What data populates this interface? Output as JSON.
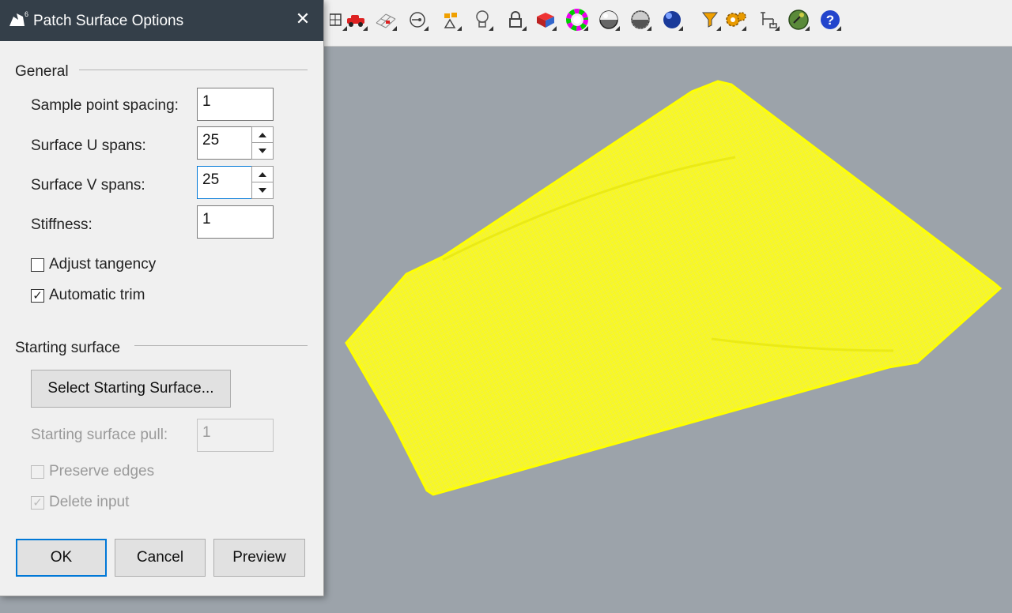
{
  "dialog": {
    "title": "Patch Surface Options",
    "close_glyph": "✕",
    "general": {
      "heading": "General",
      "sample_point_spacing": {
        "label": "Sample point spacing:",
        "value": "1"
      },
      "surface_u_spans": {
        "label": "Surface U spans:",
        "value": "25"
      },
      "surface_v_spans": {
        "label": "Surface V spans:",
        "value": "25"
      },
      "stiffness": {
        "label": "Stiffness:",
        "value": "1"
      },
      "adjust_tangency": {
        "label": "Adjust tangency",
        "checked": false
      },
      "automatic_trim": {
        "label": "Automatic trim",
        "checked": true
      }
    },
    "starting_surface": {
      "heading": "Starting surface",
      "select_button": "Select Starting Surface...",
      "pull": {
        "label": "Starting surface pull:",
        "value": "1"
      },
      "preserve_edges": {
        "label": "Preserve edges",
        "checked": false
      },
      "delete_input": {
        "label": "Delete input",
        "checked": true
      }
    },
    "buttons": {
      "ok": "OK",
      "cancel": "Cancel",
      "preview": "Preview"
    }
  },
  "checkmark_glyph": "✓",
  "toolbar": {
    "icons": [
      "viewport-layout-icon",
      "car-icon",
      "grid-icon",
      "point-icon",
      "named-position-icon",
      "light-bulb-icon",
      "lock-icon",
      "shaded-box-icon",
      "color-wheel-icon",
      "shaded-sphere-icon",
      "ghosted-sphere-icon",
      "rendered-sphere-icon",
      "funnel-icon",
      "gear-icon",
      "layout-icon",
      "globe-icon",
      "help-icon"
    ]
  },
  "colors": {
    "title_bar": "#343f49",
    "mesh": "#ffff00",
    "viewport_bg": "#9ca3aa",
    "accent": "#0078d7"
  }
}
